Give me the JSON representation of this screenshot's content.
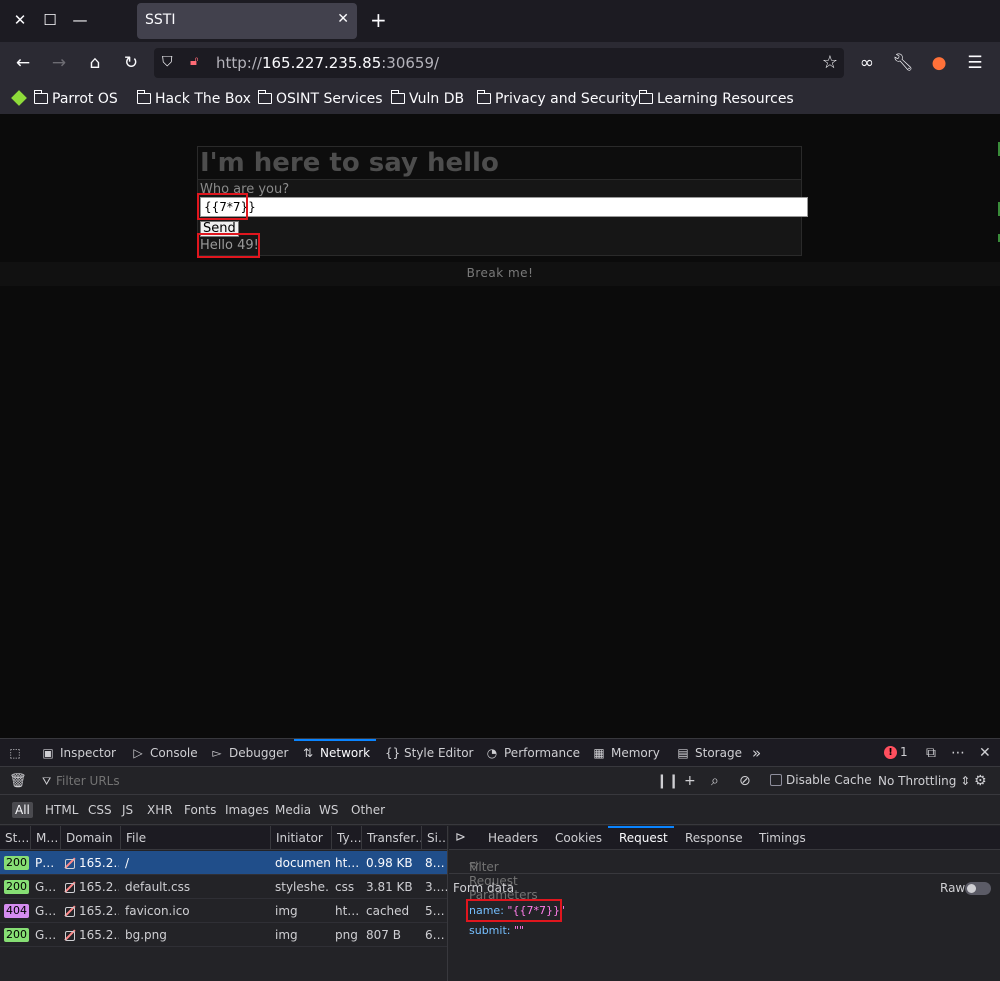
{
  "browser": {
    "tab_title": "SSTI",
    "tab_close": "✕",
    "new_tab": "+",
    "url_scheme": "http://",
    "url_host": "165.227.235.85",
    "url_rest": ":30659/",
    "bookmarks": [
      "Parrot OS",
      "Hack The Box",
      "OSINT Services",
      "Vuln DB",
      "Privacy and Security",
      "Learning Resources"
    ]
  },
  "page": {
    "heading": "I'm here to say hello",
    "who_label": "Who are you?",
    "input_value": "{{7*7}}",
    "send_label": "Send",
    "result_text": "Hello 49!",
    "footer_text": "Break me!"
  },
  "devtools": {
    "tabs": [
      {
        "label": "Inspector",
        "icon": "inspector-icon"
      },
      {
        "label": "Console",
        "icon": "console-icon"
      },
      {
        "label": "Debugger",
        "icon": "debugger-icon"
      },
      {
        "label": "Network",
        "icon": "network-icon"
      },
      {
        "label": "Style Editor",
        "icon": "style-editor-icon"
      },
      {
        "label": "Performance",
        "icon": "performance-icon"
      },
      {
        "label": "Memory",
        "icon": "memory-icon"
      },
      {
        "label": "Storage",
        "icon": "storage-icon"
      }
    ],
    "active_tab": "Network",
    "error_count": "1",
    "filter_placeholder": "Filter URLs",
    "disable_cache": "Disable Cache",
    "throttling": "No Throttling ⇕",
    "type_filters": [
      "All",
      "HTML",
      "CSS",
      "JS",
      "XHR",
      "Fonts",
      "Images",
      "Media",
      "WS",
      "Other"
    ],
    "active_type_filter": "All",
    "columns": [
      "St…",
      "M…",
      "Domain",
      "File",
      "Initiator",
      "Ty…",
      "Transfer…",
      "Si…"
    ],
    "requests": [
      {
        "status": "200",
        "method": "P…",
        "domain": "165.2…",
        "file": "/",
        "initiator": "document",
        "type": "ht…",
        "transferred": "0.98 KB",
        "size": "8…"
      },
      {
        "status": "200",
        "method": "G…",
        "domain": "165.2…",
        "file": "default.css",
        "initiator": "styleshe…",
        "type": "css",
        "transferred": "3.81 KB",
        "size": "3.…"
      },
      {
        "status": "404",
        "method": "G…",
        "domain": "165.2…",
        "file": "favicon.ico",
        "initiator": "img",
        "type": "ht…",
        "transferred": "cached",
        "size": "5…"
      },
      {
        "status": "200",
        "method": "G…",
        "domain": "165.2…",
        "file": "bg.png",
        "initiator": "img",
        "type": "png",
        "transferred": "807 B",
        "size": "6…"
      }
    ],
    "side_tabs": [
      "Headers",
      "Cookies",
      "Request",
      "Response",
      "Timings"
    ],
    "active_side_tab": "Request",
    "param_filter": "Filter Request Parameters",
    "form_data_label": "Form data",
    "raw_label": "Raw",
    "params": [
      {
        "key": "name:",
        "value": "\"{{7*7}}\""
      },
      {
        "key": "submit:",
        "value": "\"\""
      }
    ]
  },
  "colors": {
    "highlight": "#e0161e",
    "accent": "#0a84ff",
    "status_ok": "#86de74",
    "status_404": "#d58cf0"
  }
}
